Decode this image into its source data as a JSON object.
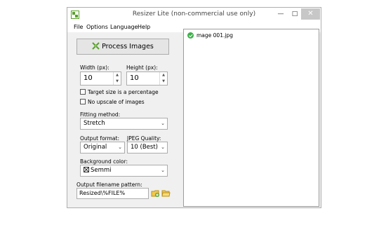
{
  "window": {
    "title": "Resizer Lite (non-commercial use only)"
  },
  "menu": [
    "File",
    "Options",
    "Language",
    "Help"
  ],
  "process_button": "Process Images",
  "width": {
    "label": "Width (px):",
    "value": "10"
  },
  "height": {
    "label": "Height (px):",
    "value": "10"
  },
  "checkboxes": [
    {
      "label": "Target size is a percentage",
      "checked": false
    },
    {
      "label": "No upscale of images",
      "checked": false
    }
  ],
  "fitting": {
    "label": "Fitting method:",
    "value": "Stretch"
  },
  "output_format": {
    "label": "Output format:",
    "value": "Original"
  },
  "jpeg_quality": {
    "label": "JPEG Quality:",
    "value": "10 (Best)"
  },
  "background": {
    "label": "Background color:",
    "value": "Semmi"
  },
  "pattern": {
    "label": "Output filename pattern:",
    "value": "Resized\\%FILE%"
  },
  "files": [
    {
      "name": "mage 001.jpg",
      "status": "ok"
    }
  ],
  "colors": {
    "status_ok": "#3db04a",
    "icon_green": "#5aa02c"
  }
}
